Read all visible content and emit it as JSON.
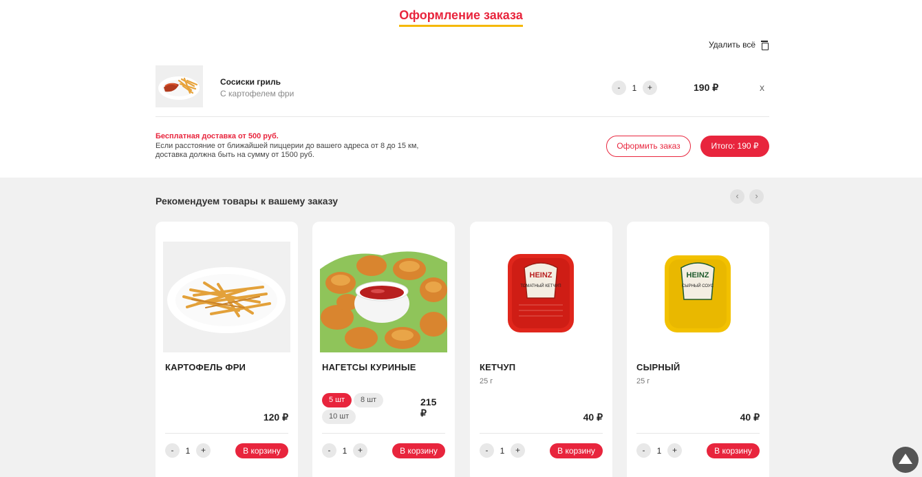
{
  "page_title": "Оформление заказа",
  "clear_all_label": "Удалить всё",
  "cart": {
    "items": [
      {
        "name": "Сосиски гриль",
        "description": "С картофелем фри",
        "qty": "1",
        "price": "190 ₽",
        "remove": "x",
        "minus": "-",
        "plus": "+"
      }
    ]
  },
  "delivery": {
    "headline": "Бесплатная доставка от 500 руб.",
    "line1": "Если расстояние от ближайшей пиццерии до вашего адреса от 8 до 15 км,",
    "line2": "доставка должна быть на сумму от 1500 руб."
  },
  "checkout_label": "Оформить заказ",
  "total_label": "Итого: 190 ₽",
  "recommend": {
    "title": "Рекомендуем товары к вашему заказу",
    "prev": "‹",
    "next": "›",
    "products": [
      {
        "name": "КАРТОФЕЛЬ ФРИ",
        "price": "120 ₽",
        "qty": "1",
        "minus": "-",
        "plus": "+",
        "add": "В корзину"
      },
      {
        "name": "НАГЕТСЫ КУРИНЫЕ",
        "options": [
          "5 шт",
          "8 шт",
          "10 шт"
        ],
        "price_line1": "215",
        "price_line2": "₽",
        "qty": "1",
        "minus": "-",
        "plus": "+",
        "add": "В корзину"
      },
      {
        "name": "КЕТЧУП",
        "weight": "25 г",
        "price": "40 ₽",
        "qty": "1",
        "minus": "-",
        "plus": "+",
        "add": "В корзину",
        "logo_text": "HEINZ",
        "label_text": "ТОМАТНЫЙ КЕТЧУП"
      },
      {
        "name": "СЫРНЫЙ",
        "weight": "25 г",
        "price": "40 ₽",
        "qty": "1",
        "minus": "-",
        "plus": "+",
        "add": "В корзину",
        "logo_text": "HEINZ",
        "label_text": "СЫРНЫЙ СОУС"
      }
    ]
  },
  "colors": {
    "accent": "#e8253d",
    "underline": "#f5b800",
    "section_bg": "#f1f1f1"
  }
}
